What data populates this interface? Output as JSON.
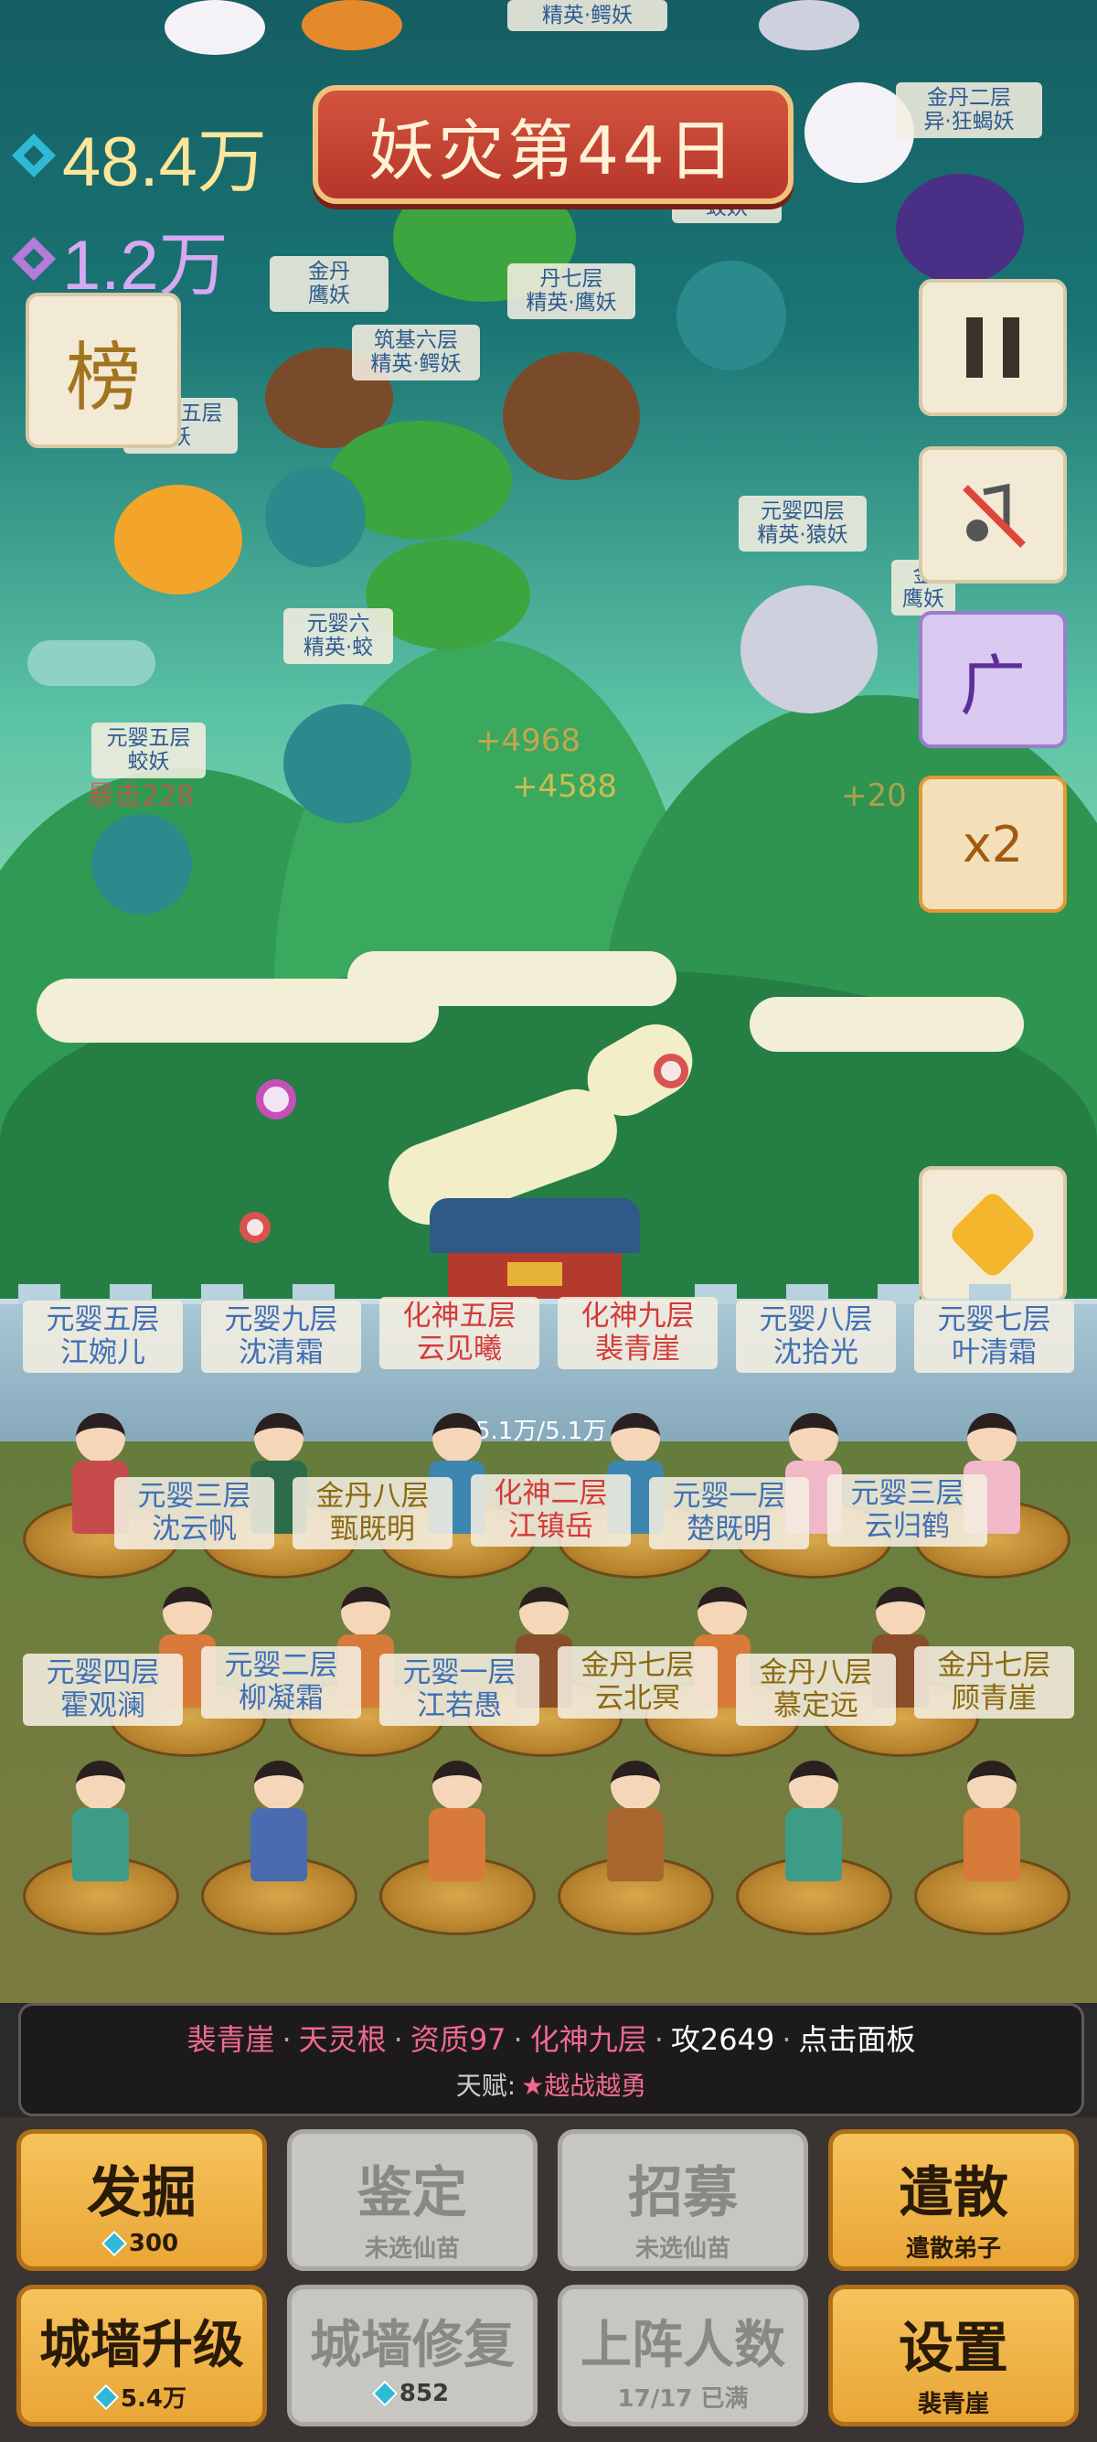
{
  "currencies": {
    "spirit_stones": "48.4万",
    "purple_crystals": "1.2万"
  },
  "title": "妖灾第44日",
  "leaderboard_label": "榜",
  "side_buttons": {
    "pause": "pause",
    "music_off": "music-off",
    "ad_label": "广",
    "speed_label": "x2"
  },
  "enemies": [
    {
      "line1": "精英·鳄妖",
      "line2": ""
    },
    {
      "line1": "金丹二层",
      "line2": "异·狂蝎妖"
    },
    {
      "line1": "蛟妖",
      "line2": ""
    },
    {
      "line1": "金丹",
      "line2": "鹰妖"
    },
    {
      "line1": "丹七层",
      "line2": "精英·鹰妖"
    },
    {
      "line1": "筑基六层",
      "line2": "精英·鳄妖"
    },
    {
      "line1": "元婴五层",
      "line2": "妖"
    },
    {
      "line1": "元婴四层",
      "line2": "精英·猿妖"
    },
    {
      "line1": "元婴六",
      "line2": "精英·蛟"
    },
    {
      "line1": "金",
      "line2": "鹰妖"
    },
    {
      "line1": "元婴五层",
      "line2": "蛟妖"
    }
  ],
  "battle_texts": [
    "+4968",
    "+4588",
    "+20",
    "暴击228"
  ],
  "wall_hp": "5.1万/5.1万",
  "defenders": [
    {
      "realm": "元婴五层",
      "name": "江婉儿",
      "color": "#3f6fb4"
    },
    {
      "realm": "元婴九层",
      "name": "沈清霜",
      "color": "#3f6fb4"
    },
    {
      "realm": "化神五层",
      "name": "云见曦",
      "color": "#d43a3a"
    },
    {
      "realm": "化神九层",
      "name": "裴青崖",
      "color": "#d43a3a"
    },
    {
      "realm": "元婴八层",
      "name": "沈拾光",
      "color": "#3f6fb4"
    },
    {
      "realm": "元婴七层",
      "name": "叶清霜",
      "color": "#3f6fb4"
    }
  ],
  "disciples_row2": [
    {
      "realm": "元婴三层",
      "name": "沈云帆",
      "color": "#3f6fb4"
    },
    {
      "realm": "金丹八层",
      "name": "甄既明",
      "color": "#8a6a12"
    },
    {
      "realm": "化神二层",
      "name": "江镇岳",
      "color": "#d43a3a"
    },
    {
      "realm": "元婴一层",
      "name": "楚既明",
      "color": "#3f6fb4"
    },
    {
      "realm": "元婴三层",
      "name": "云归鹤",
      "color": "#3f6fb4"
    }
  ],
  "disciples_row3": [
    {
      "realm": "元婴四层",
      "name": "霍观澜",
      "color": "#3f6fb4"
    },
    {
      "realm": "元婴二层",
      "name": "柳凝霜",
      "color": "#3f6fb4"
    },
    {
      "realm": "元婴一层",
      "name": "江若愚",
      "color": "#3f6fb4"
    },
    {
      "realm": "金丹七层",
      "name": "云北冥",
      "color": "#8a6a12"
    },
    {
      "realm": "金丹八层",
      "name": "慕定远",
      "color": "#8a6a12"
    },
    {
      "realm": "金丹七层",
      "name": "顾青崖",
      "color": "#8a6a12"
    }
  ],
  "info": {
    "name": "裴青崖",
    "root": "天灵根",
    "aptitude": "资质97",
    "realm": "化神九层",
    "attack": "攻2649",
    "hint": "点击面板",
    "talent_label": "天赋:",
    "talent": "★越战越勇"
  },
  "actions": [
    {
      "label": "发掘",
      "sub": "300",
      "diamond": true,
      "enabled": true
    },
    {
      "label": "鉴定",
      "sub": "未选仙苗",
      "diamond": false,
      "enabled": false
    },
    {
      "label": "招募",
      "sub": "未选仙苗",
      "diamond": false,
      "enabled": false
    },
    {
      "label": "遣散",
      "sub": "遣散弟子",
      "diamond": false,
      "enabled": true
    },
    {
      "label": "城墙升级",
      "sub": "5.4万",
      "diamond": true,
      "enabled": true
    },
    {
      "label": "城墙修复",
      "sub": "852",
      "diamond": true,
      "enabled": false
    },
    {
      "label": "上阵人数",
      "sub": "17/17 已满",
      "diamond": false,
      "enabled": false
    },
    {
      "label": "设置",
      "sub": "裴青崖",
      "diamond": false,
      "enabled": true
    }
  ],
  "colors": {
    "gold_button": "#f0b447",
    "disabled_button": "#c8c6c1",
    "title_red": "#c3402f",
    "stone_cyan": "#2fb9d7",
    "crystal_purple": "#b47bd8"
  }
}
